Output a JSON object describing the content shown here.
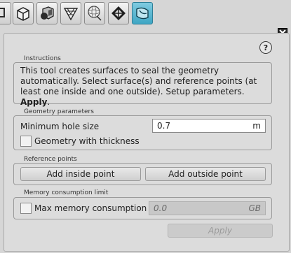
{
  "toolbar": {
    "tools": [
      {
        "icon": "cube-on-plane-icon"
      },
      {
        "icon": "cube-wireframe-icon"
      },
      {
        "icon": "hollow-cube-icon"
      },
      {
        "icon": "triangle-mesh-icon"
      },
      {
        "icon": "sphere-mesh-icon"
      },
      {
        "icon": "patch-grid-icon"
      },
      {
        "icon": "seal-surface-icon",
        "active": true
      }
    ]
  },
  "panel": {
    "close_icon": "close-icon",
    "help_label": "?",
    "instructions": {
      "title": "Instructions",
      "text": "This tool creates surfaces to seal the geometry automatically. Select surface(s) and reference points (at least one inside and one outside). Setup parameters.",
      "emphasis": "Apply"
    },
    "geometry": {
      "title": "Geometry parameters",
      "min_hole_label": "Minimum hole size",
      "min_hole_value": "0.7",
      "min_hole_unit": "m",
      "thickness_label": "Geometry with thickness"
    },
    "reference": {
      "title": "Reference points",
      "add_inside": "Add inside point",
      "add_outside": "Add outside point"
    },
    "memory": {
      "title": "Memory consumption limit",
      "max_label": "Max memory consumption",
      "max_value": "0.0",
      "max_unit": "GB"
    },
    "apply_label": "Apply"
  },
  "colors": {
    "active_tool": "#3fa6c4",
    "panel_bg": "#dcdcdc"
  }
}
